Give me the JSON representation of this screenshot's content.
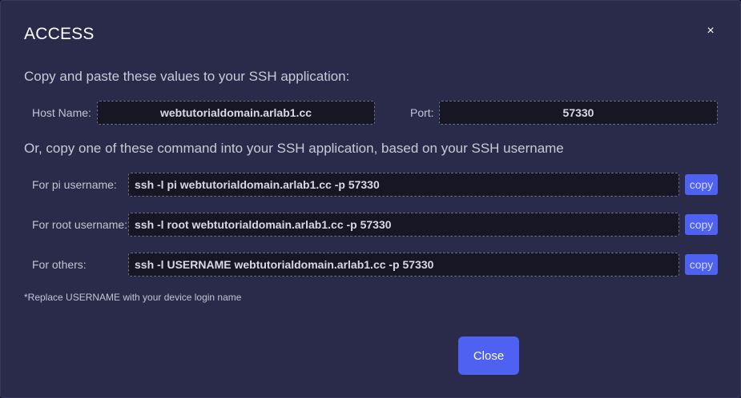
{
  "dialog": {
    "title": "ACCESS",
    "close_icon": "×",
    "intro": "Copy and paste these values to your SSH application:",
    "host": {
      "label": "Host Name:",
      "value": "webtutorialdomain.arlab1.cc"
    },
    "port": {
      "label": "Port:",
      "value": "57330"
    },
    "commands_intro": "Or, copy one of these command into your SSH application, based on your SSH username",
    "commands": [
      {
        "label": "For pi username:",
        "command": "ssh -l pi webtutorialdomain.arlab1.cc -p 57330",
        "copy_label": "copy"
      },
      {
        "label": "For root username:",
        "command": "ssh -l root webtutorialdomain.arlab1.cc -p 57330",
        "copy_label": "copy"
      },
      {
        "label": "For others:",
        "command": "ssh -l USERNAME webtutorialdomain.arlab1.cc -p 57330",
        "copy_label": "copy"
      }
    ],
    "note": "*Replace USERNAME with your device login name",
    "close_label": "Close"
  }
}
